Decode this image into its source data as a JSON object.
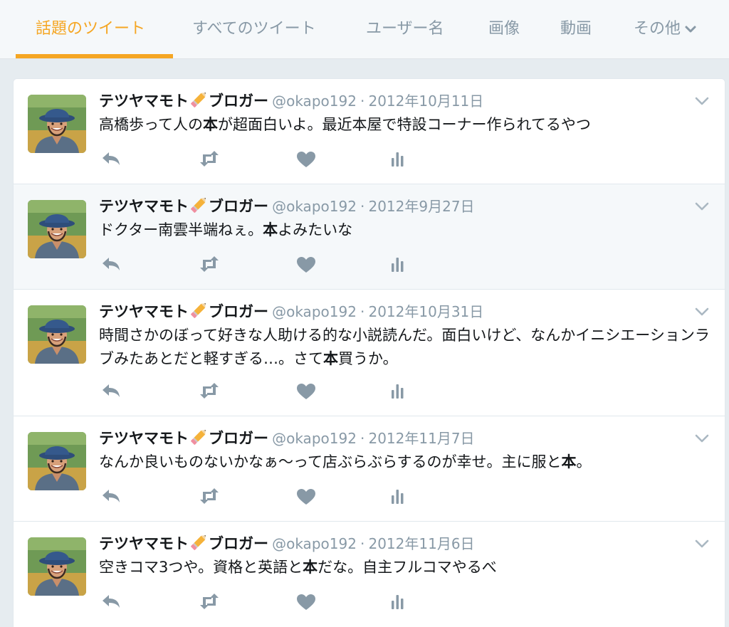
{
  "tabs": [
    {
      "label": "話題のツイート",
      "active": true
    },
    {
      "label": "すべてのツイート",
      "active": false
    },
    {
      "label": "ユーザー名",
      "active": false
    },
    {
      "label": "画像",
      "active": false
    },
    {
      "label": "動画",
      "active": false
    },
    {
      "label": "その他",
      "active": false
    }
  ],
  "colors": {
    "accent": "#f5a623",
    "muted": "#8899a6",
    "hover_bg": "#f5f8fa"
  },
  "tweets": [
    {
      "name": "テツヤマモト",
      "name_suffix": "ブロガー",
      "handle": "@okapo192",
      "separator": "·",
      "date": "2012年10月11日",
      "text_before": "高橋歩って人の",
      "keyword": "本",
      "text_after": "が超面白いよ。最近本屋で特設コーナー作られてるやつ"
    },
    {
      "name": "テツヤマモト",
      "name_suffix": "ブロガー",
      "handle": "@okapo192",
      "separator": "·",
      "date": "2012年9月27日",
      "text_before": "ドクター南雲半端ねぇ。",
      "keyword": "本",
      "text_after": "よみたいな"
    },
    {
      "name": "テツヤマモト",
      "name_suffix": "ブロガー",
      "handle": "@okapo192",
      "separator": "·",
      "date": "2012年10月31日",
      "text_before": "時間さかのぼって好きな人助ける的な小説読んだ。面白いけど、なんかイニシエーションラブみたあとだと軽すぎる…。さて",
      "keyword": "本",
      "text_after": "買うか。"
    },
    {
      "name": "テツヤマモト",
      "name_suffix": "ブロガー",
      "handle": "@okapo192",
      "separator": "·",
      "date": "2012年11月7日",
      "text_before": "なんか良いものないかなぁ〜って店ぶらぶらするのが幸せ。主に服と",
      "keyword": "本",
      "text_after": "。"
    },
    {
      "name": "テツヤマモト",
      "name_suffix": "ブロガー",
      "handle": "@okapo192",
      "separator": "·",
      "date": "2012年11月6日",
      "text_before": "空きコマ3つや。資格と英語と",
      "keyword": "本",
      "text_after": "だな。自主フルコマやるべ"
    }
  ],
  "actions": [
    "reply-icon",
    "retweet-icon",
    "like-icon",
    "analytics-icon"
  ]
}
